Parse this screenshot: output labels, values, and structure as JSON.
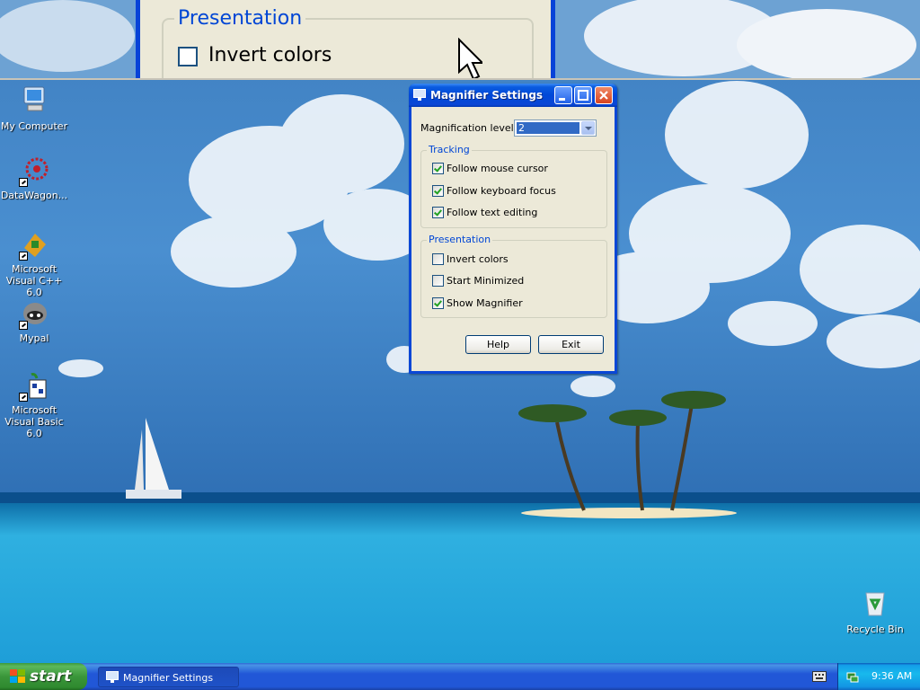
{
  "magnifier_view": {
    "group_title": "Presentation",
    "checkbox_label": "Invert colors"
  },
  "desktop": {
    "icons": [
      {
        "label": "My Computer",
        "icon": "my-computer-icon"
      },
      {
        "label": "DataWagon...",
        "icon": "datawagon-icon"
      },
      {
        "label": "Microsoft Visual C++ 6.0",
        "icon": "visual-cpp-icon"
      },
      {
        "label": "Mypal",
        "icon": "mypal-icon"
      },
      {
        "label": "Microsoft Visual Basic 6.0",
        "icon": "visual-basic-icon"
      },
      {
        "label": "Recycle Bin",
        "icon": "recycle-bin-icon"
      }
    ]
  },
  "dialog": {
    "title": "Magnifier Settings",
    "magnification_label": "Magnification level:",
    "magnification_value": "2",
    "tracking": {
      "title": "Tracking",
      "items": [
        {
          "label": "Follow mouse cursor",
          "checked": true
        },
        {
          "label": "Follow keyboard focus",
          "checked": true
        },
        {
          "label": "Follow text editing",
          "checked": true
        }
      ]
    },
    "presentation": {
      "title": "Presentation",
      "items": [
        {
          "label": "Invert colors",
          "checked": false
        },
        {
          "label": "Start Minimized",
          "checked": false
        },
        {
          "label": "Show Magnifier",
          "checked": true
        }
      ]
    },
    "help_label": "Help",
    "exit_label": "Exit"
  },
  "taskbar": {
    "start_label": "start",
    "task_label": "Magnifier Settings",
    "clock": "9:36 AM"
  }
}
